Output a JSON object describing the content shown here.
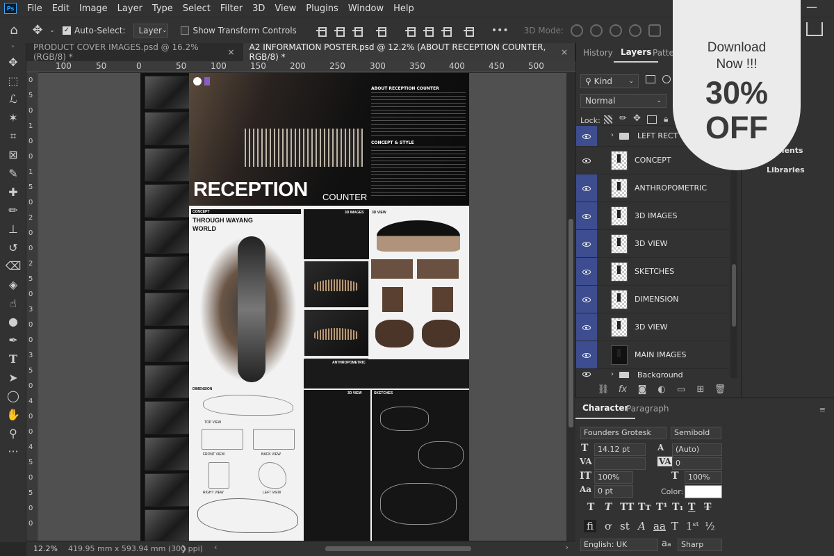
{
  "menubar": {
    "items": [
      "File",
      "Edit",
      "Image",
      "Layer",
      "Type",
      "Select",
      "Filter",
      "3D",
      "View",
      "Plugins",
      "Window",
      "Help"
    ]
  },
  "options": {
    "auto_select_label": "Auto-Select:",
    "auto_select_checked": true,
    "auto_select_value": "Layer",
    "transform_label": "Show Transform Controls",
    "transform_checked": false,
    "mode_3d_label": "3D Mode:",
    "more": "•••"
  },
  "tabs": [
    {
      "label": "PRODUCT COVER IMAGES.psd @ 16.2% (RGB/8) *",
      "active": false
    },
    {
      "label": "A2 INFORMATION POSTER.psd @ 12.2% (ABOUT RECEPTION COUNTER, RGB/8) *",
      "active": true
    }
  ],
  "ruler": {
    "h_ticks": [
      "100",
      "50",
      "0",
      "50",
      "100",
      "150",
      "200",
      "250",
      "300",
      "350",
      "400",
      "450",
      "500"
    ],
    "v_ticks": [
      "0",
      "5",
      "0",
      "1",
      "0",
      "0",
      "1",
      "5",
      "0",
      "2",
      "0",
      "0",
      "2",
      "5",
      "0",
      "3",
      "0",
      "0",
      "3",
      "5",
      "0",
      "4",
      "0",
      "0",
      "4",
      "5",
      "0",
      "5",
      "0",
      "0"
    ]
  },
  "poster": {
    "hero_title": "RECEPTION",
    "hero_subtitle": "COUNTER",
    "about_heading": "ABOUT RECEPTION COUNTER",
    "concept_style_heading": "CONCEPT & STYLE",
    "concept_label": "CONCEPT",
    "concept_title_1": "THROUGH WAYANG",
    "concept_title_2": "WORLD",
    "images_3d_label": "3D IMAGES",
    "view_3d_label": "3D VIEW",
    "view_3d_label_2": "3D VIEW",
    "anthropometric_label": "ANTHROPOMETRIC",
    "dimension_label": "DIMENSION",
    "sketches_label": "SKETCHES",
    "top_view": "TOP VIEW",
    "front_view": "FRONT VIEW",
    "back_view": "BACK VIEW",
    "right_view": "RIGHT VIEW",
    "left_view": "LEFT VIEW"
  },
  "layers_panel": {
    "tabs": [
      "History",
      "Layers",
      "Patterns"
    ],
    "kind_label": "Kind",
    "blend_mode": "Normal",
    "lock_label": "Lock:",
    "layers": [
      {
        "name": "LEFT RECT",
        "type": "group"
      },
      {
        "name": "CONCEPT",
        "type": "layer"
      },
      {
        "name": "ANTHROPOMETRIC",
        "type": "layer"
      },
      {
        "name": "3D IMAGES",
        "type": "layer"
      },
      {
        "name": "3D VIEW",
        "type": "layer"
      },
      {
        "name": "SKETCHES",
        "type": "layer"
      },
      {
        "name": "DIMENSION",
        "type": "layer"
      },
      {
        "name": "3D VIEW",
        "type": "layer"
      },
      {
        "name": "MAIN IMAGES",
        "type": "layer"
      },
      {
        "name": "Background",
        "type": "group"
      }
    ]
  },
  "side_panel": {
    "item_adjustments_partial": "ments",
    "item_libraries_partial": "Libraries"
  },
  "character_panel": {
    "tabs": [
      "Character",
      "Paragraph"
    ],
    "font_family": "Founders Grotesk",
    "font_style": "Semibold",
    "font_size": "14.12 pt",
    "leading": "(Auto)",
    "kerning": "",
    "tracking": "0",
    "vertical_scale": "100%",
    "horizontal_scale": "100%",
    "baseline_shift": "0 pt",
    "color_label": "Color:",
    "color_value": "#ffffff",
    "language": "English: UK",
    "antialias_symbol": "a",
    "antialias_symbol_small": "a",
    "antialias": "Sharp"
  },
  "status": {
    "zoom": "12.2%",
    "doc_size": "419.95 mm x 593.94 mm (300 ppi)",
    "arrow": "❯"
  },
  "promo": {
    "line1": "Download",
    "line2": "Now !!!",
    "percent": "30%",
    "off": "OFF"
  }
}
